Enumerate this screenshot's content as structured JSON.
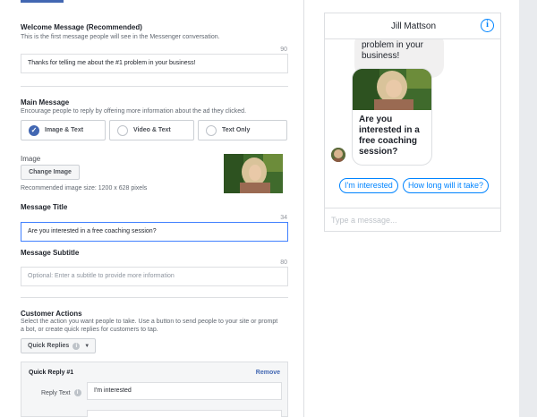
{
  "welcome": {
    "title": "Welcome Message (Recommended)",
    "desc": "This is the first message people will see in the Messenger conversation.",
    "counter": "90",
    "value": "Thanks for telling me about the #1 problem in your business!"
  },
  "main_message": {
    "title": "Main Message",
    "desc": "Encourage people to reply by offering more information about the ad they clicked.",
    "options": [
      "Image & Text",
      "Video & Text",
      "Text Only"
    ],
    "selected": "Image & Text"
  },
  "image": {
    "title": "Image",
    "change_label": "Change Image",
    "hint": "Recommended image size: 1200 x 628 pixels"
  },
  "message_title": {
    "title": "Message Title",
    "counter": "34",
    "value": "Are you interested in a free coaching session?"
  },
  "message_subtitle": {
    "title": "Message Subtitle",
    "counter": "80",
    "placeholder": "Optional: Enter a subtitle to provide more information"
  },
  "customer_actions": {
    "title": "Customer Actions",
    "desc": "Select the action you want people to take. Use a button to send people to your site or prompt a bot, or create quick replies for customers to tap.",
    "dropdown_label": "Quick Replies"
  },
  "quick_reply": {
    "title": "Quick Reply #1",
    "remove_label": "Remove",
    "reply_text_label": "Reply Text",
    "reply_text_value": "I'm interested"
  },
  "preview": {
    "contact_name": "Jill Mattson",
    "bubble_text": "problem in your business!",
    "card_title": "Are you interested in a free coaching session?",
    "quick_replies": [
      "I'm interested",
      "How long will it take?"
    ],
    "compose_placeholder": "Type a message..."
  },
  "colors": {
    "accent": "#4267b2",
    "messenger_blue": "#0084ff",
    "focus_border": "#4080ff"
  }
}
